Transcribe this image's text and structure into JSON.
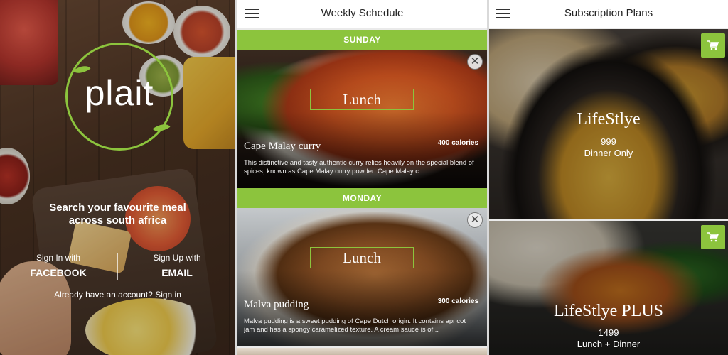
{
  "login": {
    "logo_text": "plait",
    "tagline_line1": "Search your favourite meal",
    "tagline_line2": "across south africa",
    "facebook_small": "Sign In with",
    "facebook_big": "FACEBOOK",
    "email_small": "Sign Up with",
    "email_big": "EMAIL",
    "have_account": "Already have an account? Sign in"
  },
  "schedule": {
    "title": "Weekly Schedule",
    "days": [
      {
        "day": "SUNDAY",
        "meal_type": "Lunch",
        "name": "Cape Malay curry",
        "calories": "400 calories",
        "description": "This distinctive and tasty authentic curry relies heavily on the special blend of spices, known as Cape Malay curry powder. Cape Malay c..."
      },
      {
        "day": "MONDAY",
        "meal_type": "Lunch",
        "name": "Malva pudding",
        "calories": "300 calories",
        "description": "Malva pudding is a sweet pudding of Cape Dutch origin. It contains apricot jam and has a spongy caramelized texture. A cream sauce is of..."
      }
    ]
  },
  "plans": {
    "title": "Subscription Plans",
    "items": [
      {
        "name": "LifeStlye",
        "price": "999",
        "detail": "Dinner Only"
      },
      {
        "name": "LifeStlye PLUS",
        "price": "1499",
        "detail": "Lunch + Dinner"
      }
    ]
  },
  "colors": {
    "accent": "#8cc43d"
  },
  "icons": {
    "menu": "hamburger-menu-icon",
    "close": "close-icon",
    "cart": "cart-icon"
  }
}
